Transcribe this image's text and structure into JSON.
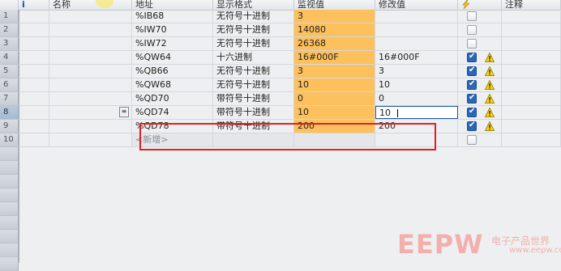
{
  "headers": {
    "info": "i",
    "name": "名称",
    "address": "地址",
    "format": "显示格式",
    "monitor": "监视值",
    "modify": "修改值",
    "comment": "注释"
  },
  "rows": [
    {
      "num": "1",
      "addr": "%IB68",
      "fmt": "无符号十进制",
      "mon": "3",
      "mod": "",
      "chk": false,
      "warn": false
    },
    {
      "num": "2",
      "addr": "%IW70",
      "fmt": "无符号十进制",
      "mon": "14080",
      "mod": "",
      "chk": false,
      "warn": false
    },
    {
      "num": "3",
      "addr": "%IW72",
      "fmt": "无符号十进制",
      "mon": "26368",
      "mod": "",
      "chk": false,
      "warn": false
    },
    {
      "num": "4",
      "addr": "%QW64",
      "fmt": "十六进制",
      "mon": "16#000F",
      "mod": "16#000F",
      "chk": true,
      "warn": true
    },
    {
      "num": "5",
      "addr": "%QB66",
      "fmt": "无符号十进制",
      "mon": "3",
      "mod": "3",
      "chk": true,
      "warn": true
    },
    {
      "num": "6",
      "addr": "%QW68",
      "fmt": "无符号十进制",
      "mon": "10",
      "mod": "10",
      "chk": true,
      "warn": true
    },
    {
      "num": "7",
      "addr": "%QD70",
      "fmt": "带符号十进制",
      "mon": "0",
      "mod": "0",
      "chk": true,
      "warn": true
    },
    {
      "num": "8",
      "addr": "%QD74",
      "fmt": "带符号十进制",
      "mon": "10",
      "mod": "10",
      "chk": true,
      "warn": true
    },
    {
      "num": "9",
      "addr": "%QD78",
      "fmt": "带符号十进制",
      "mon": "200",
      "mod": "200",
      "chk": true,
      "warn": true
    },
    {
      "num": "10",
      "addr": "<新增>",
      "fmt": "",
      "mon": "",
      "mod": "",
      "chk": false,
      "warn": false
    }
  ],
  "watermark": {
    "brand": "EEPW",
    "cn": "电子产品世界",
    "url": "www.eepw.com.cn"
  }
}
